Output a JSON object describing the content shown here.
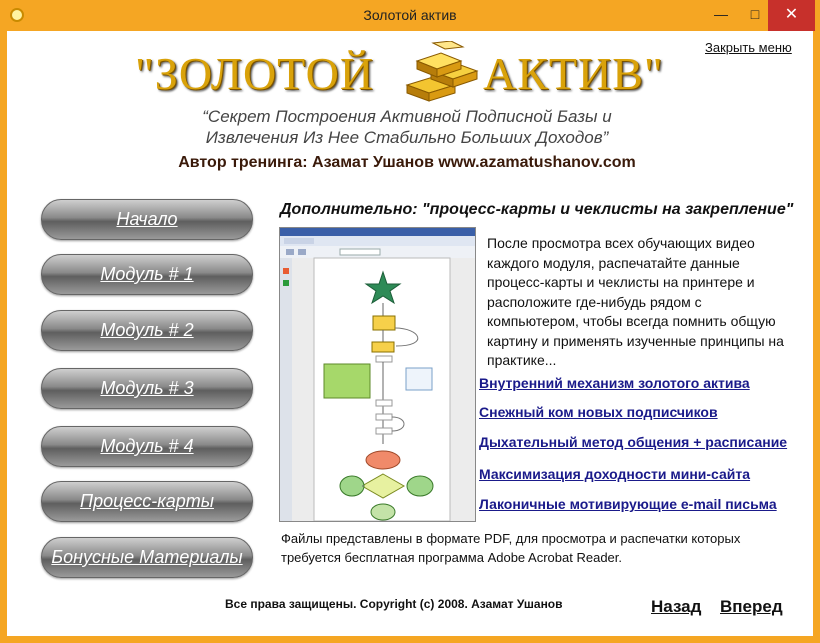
{
  "window": {
    "title": "Золотой актив"
  },
  "header": {
    "logo_left": "\"ЗОЛОТОЙ",
    "logo_right": "АКТИВ\"",
    "close_menu": "Закрыть меню",
    "tagline_line1": "“Секрет Построения Активной Подписной Базы и",
    "tagline_line2": "Извлечения Из Нее Стабильно Больших Доходов”",
    "author": "Автор тренинга: Азамат Ушанов www.azamatushanov.com"
  },
  "nav": {
    "items": [
      {
        "label": "Начало"
      },
      {
        "label": "Модуль # 1"
      },
      {
        "label": "Модуль # 2"
      },
      {
        "label": "Модуль # 3"
      },
      {
        "label": "Модуль # 4"
      },
      {
        "label": "Процесс-карты"
      },
      {
        "label": "Бонусные Материалы"
      }
    ]
  },
  "main": {
    "section_title": "Дополнительно: \"процесс-карты и чеклисты на закрепление\"",
    "intro": "После просмотра всех обучающих видео каждого модуля, распечатайте данные процесс-карты и чеклисты на принтере и расположите где-нибудь рядом с компьютером, чтобы всегда помнить общую картину и применять изученные принципы на практике...",
    "links": [
      {
        "label": "Внутренний механизм золотого актива"
      },
      {
        "label": "Снежный ком новых подписчиков"
      },
      {
        "label": "Дыхательный метод общения + расписание"
      },
      {
        "label": "Максимизация доходности мини-сайта"
      },
      {
        "label": "Лаконичные мотивирующие e-mail письма"
      }
    ],
    "footnote": "Файлы представлены в формате PDF, для просмотра и распечатки которых требуется бесплатная программа Adobe Acrobat Reader."
  },
  "footer": {
    "copyright": "Все права защищены. Copyright (c) 2008. Азамат Ушанов",
    "back": "Назад",
    "forward": "Вперед"
  },
  "colors": {
    "window_frame": "#f5a623",
    "close_red": "#c7302b",
    "link_blue": "#1a1a8a",
    "gold": "#d9a20a"
  },
  "icons": {
    "app": "gold-coin-icon",
    "minimize": "minimize-icon",
    "maximize": "maximize-icon",
    "close": "close-icon"
  }
}
